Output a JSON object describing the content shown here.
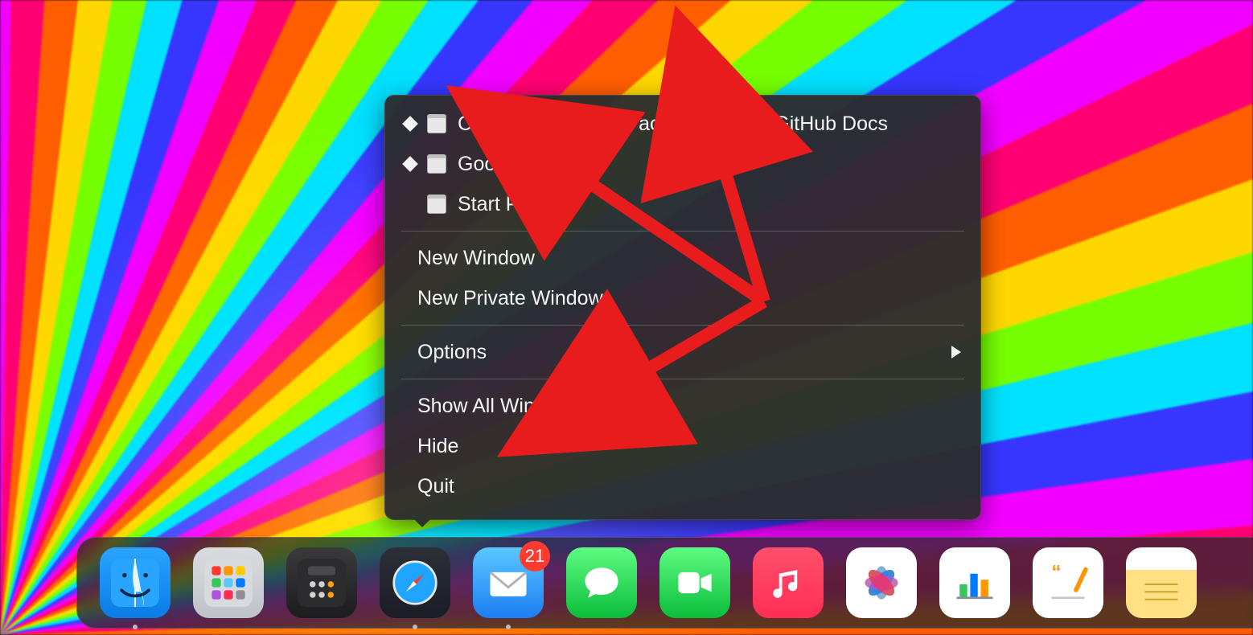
{
  "menu": {
    "windows": [
      {
        "label": "Creating a personal access token - GitHub Docs",
        "has_diamond": true
      },
      {
        "label": "Google",
        "has_diamond": true
      },
      {
        "label": "Start Page",
        "has_diamond": false
      }
    ],
    "new_window_label": "New Window",
    "new_private_window_label": "New Private Window",
    "options_label": "Options",
    "show_all_windows_label": "Show All Windows",
    "hide_label": "Hide",
    "quit_label": "Quit"
  },
  "dock": {
    "items": [
      {
        "name": "Finder",
        "icon": "finder",
        "running": true,
        "badge": null
      },
      {
        "name": "Launchpad",
        "icon": "launchpad",
        "running": false,
        "badge": null
      },
      {
        "name": "Calculator",
        "icon": "calculator",
        "running": false,
        "badge": null
      },
      {
        "name": "Safari",
        "icon": "safari",
        "running": true,
        "badge": null
      },
      {
        "name": "Mail",
        "icon": "mail",
        "running": true,
        "badge": "21"
      },
      {
        "name": "Messages",
        "icon": "messages",
        "running": false,
        "badge": null
      },
      {
        "name": "FaceTime",
        "icon": "facetime",
        "running": false,
        "badge": null
      },
      {
        "name": "Music",
        "icon": "music",
        "running": false,
        "badge": null
      },
      {
        "name": "Photos",
        "icon": "photos",
        "running": false,
        "badge": null
      },
      {
        "name": "Numbers",
        "icon": "numbers",
        "running": false,
        "badge": null
      },
      {
        "name": "Pages",
        "icon": "pages",
        "running": false,
        "badge": null
      },
      {
        "name": "Notes",
        "icon": "notes",
        "running": false,
        "badge": null
      }
    ]
  },
  "colors": {
    "annotation_arrow": "#e81c1c"
  }
}
